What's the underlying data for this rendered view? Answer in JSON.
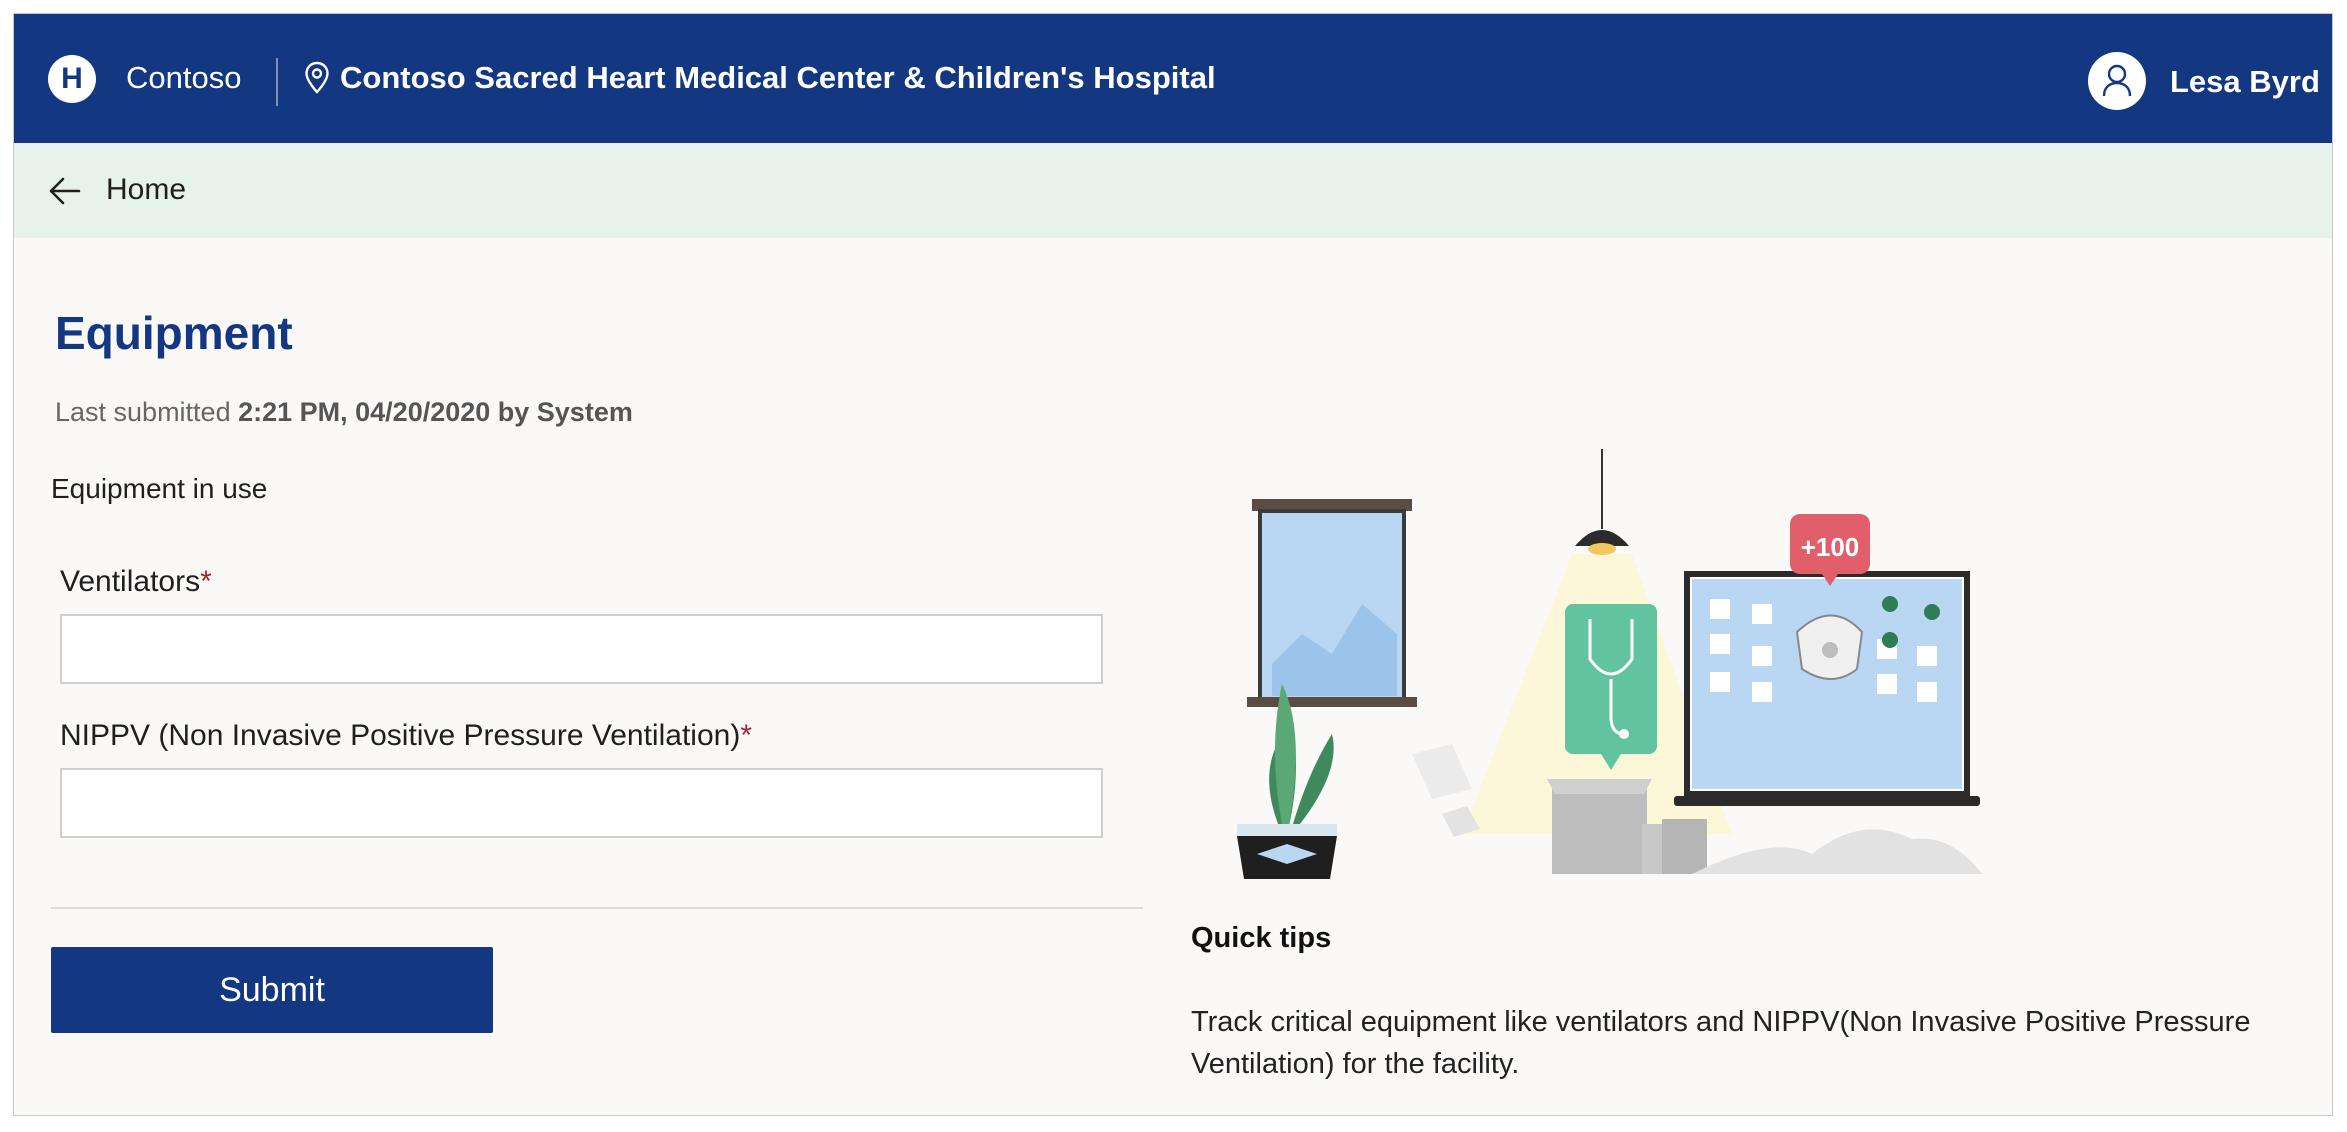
{
  "header": {
    "logo_letter": "H",
    "brand": "Contoso",
    "facility": "Contoso Sacred Heart Medical Center & Children's Hospital",
    "user": "Lesa Byrd",
    "color": "#133781"
  },
  "breadcrumb": {
    "home": "Home",
    "color": "#e8f2ec"
  },
  "page": {
    "title": "Equipment",
    "submitted_prefix": "Last submitted ",
    "submitted_value": "2:21 PM, 04/20/2020 by System",
    "section": "Equipment in use"
  },
  "form": {
    "fields": [
      {
        "label": "Ventilators",
        "required_mark": "*",
        "value": ""
      },
      {
        "label": "NIPPV (Non Invasive Positive Pressure Ventilation)",
        "required_mark": "*",
        "value": ""
      }
    ],
    "submit_label": "Submit"
  },
  "illustration": {
    "badge": "+100"
  },
  "tips": {
    "title": "Quick tips",
    "text": "Track critical equipment like ventilators and NIPPV(Non Invasive Positive Pressure Ventilation) for the facility."
  },
  "icons": [
    "hospital-logo-icon",
    "location-pin-icon",
    "user-avatar-icon",
    "back-arrow-icon"
  ]
}
